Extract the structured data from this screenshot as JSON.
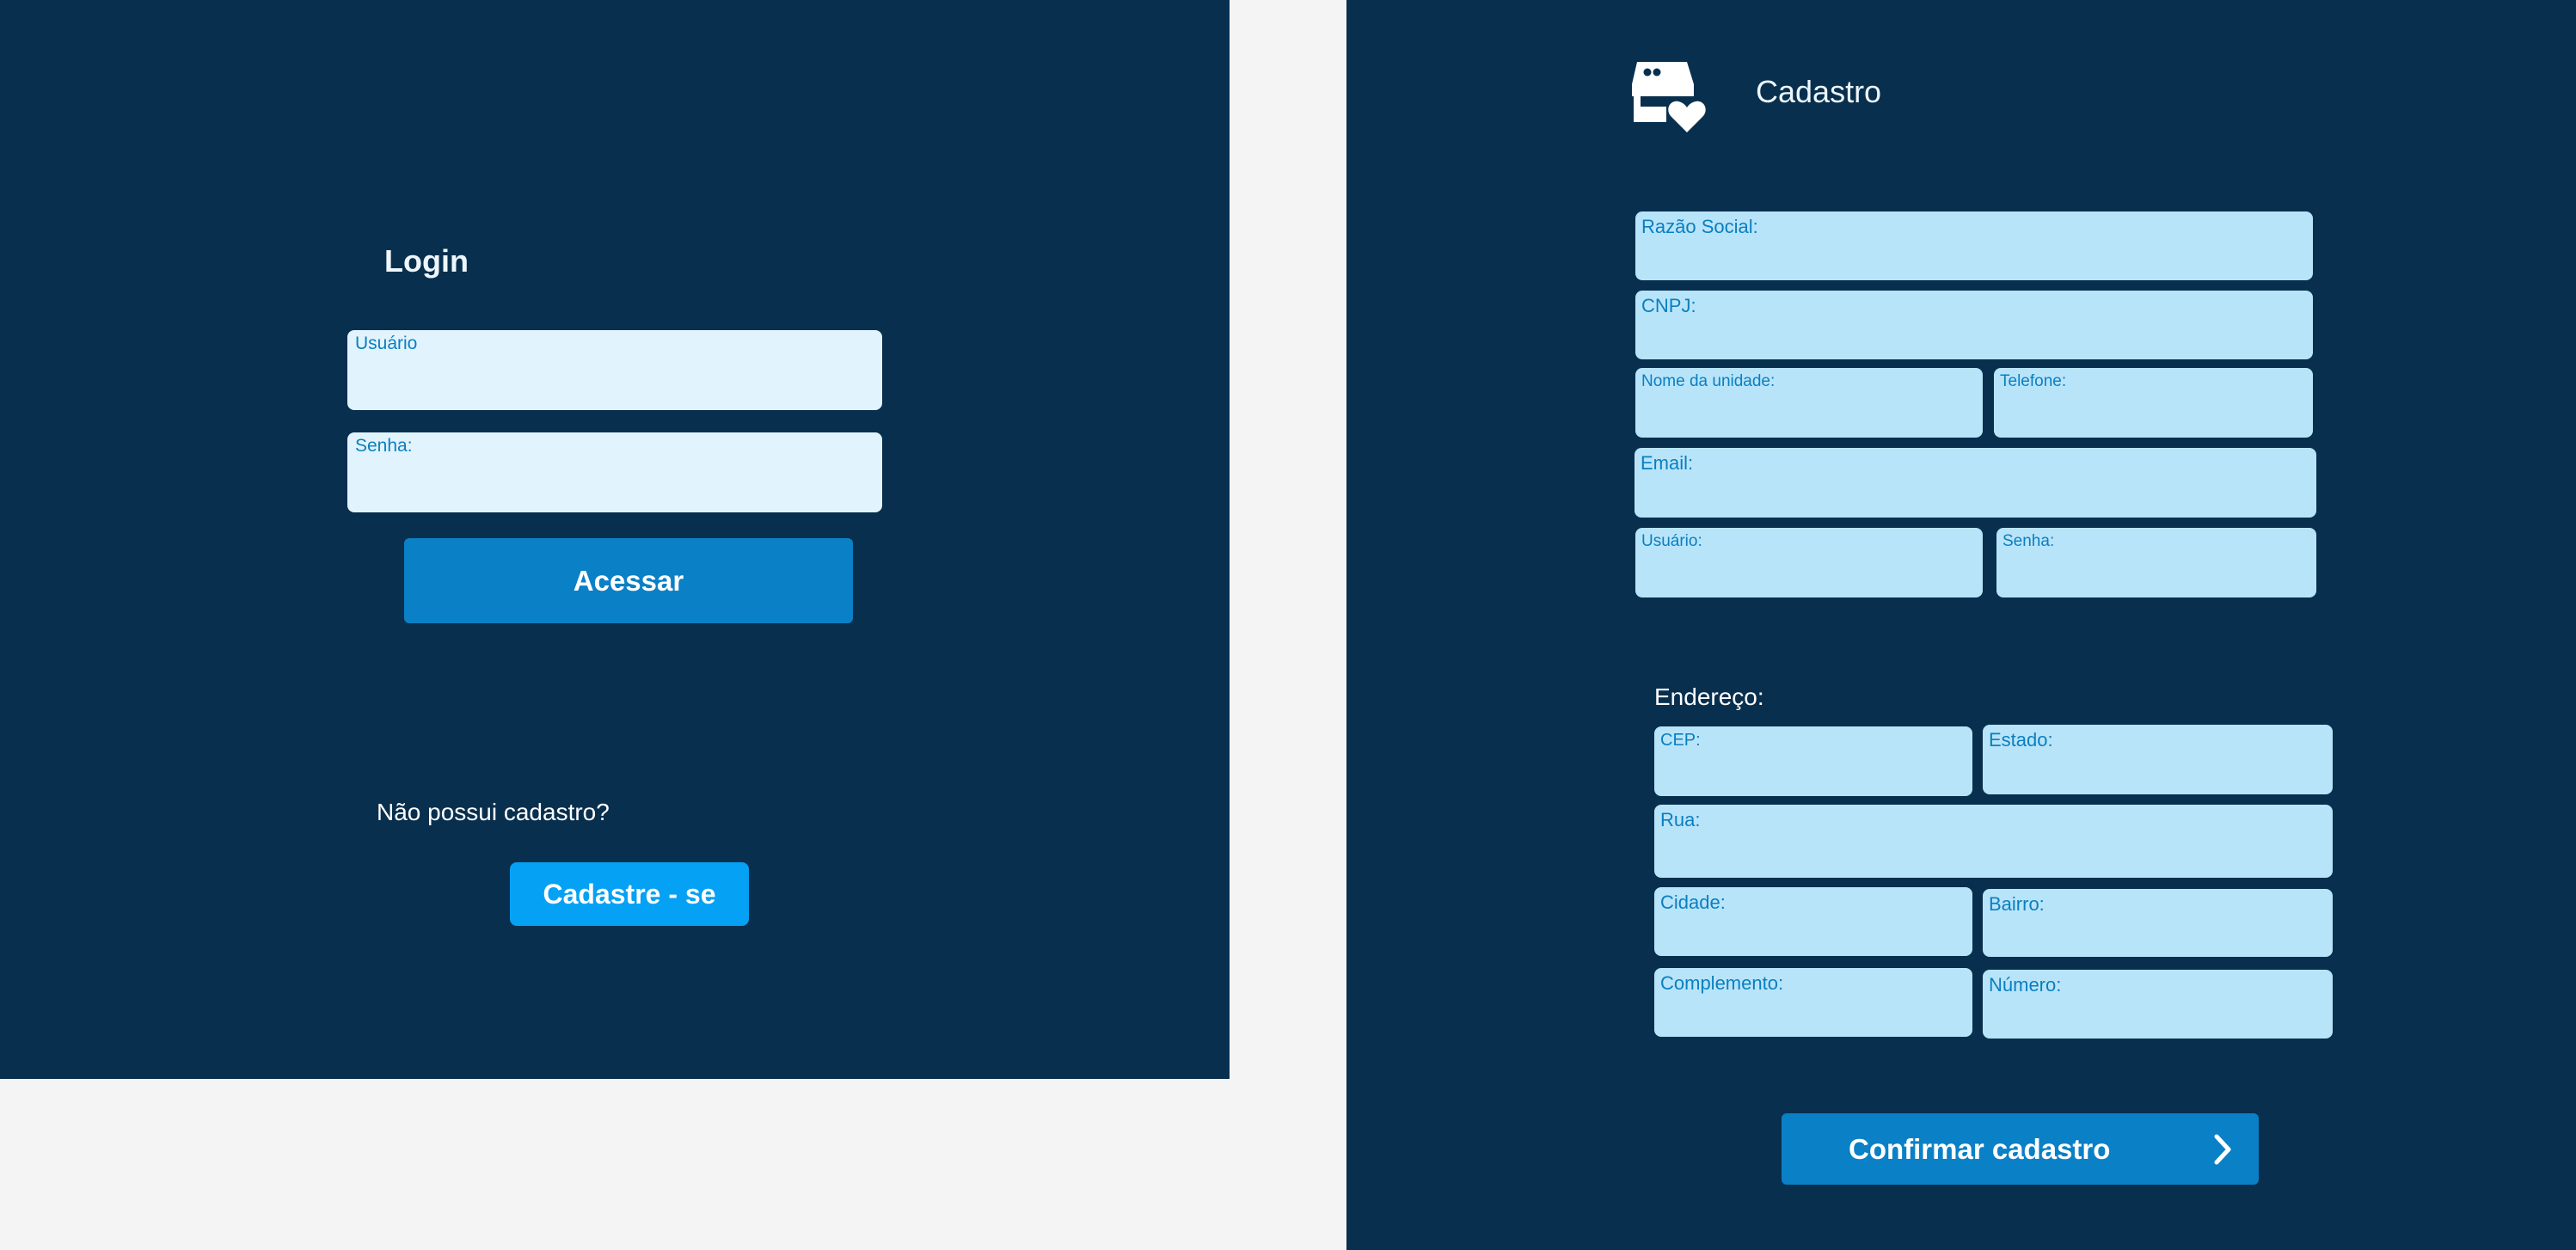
{
  "login": {
    "title": "Login",
    "username_label": "Usuário",
    "password_label": "Senha:",
    "submit_label": "Acessar",
    "no_account_text": "Não possui cadastro?",
    "register_label": "Cadastre - se"
  },
  "signup": {
    "title": "Cadastro",
    "logo_icon": "store-heart-icon",
    "fields": {
      "razao_social": "Razão Social:",
      "cnpj": "CNPJ:",
      "nome_unidade": "Nome da unidade:",
      "telefone": "Telefone:",
      "email": "Email:",
      "usuario": "Usuário:",
      "senha": "Senha:"
    },
    "address_heading": "Endereço:",
    "address": {
      "cep": "CEP:",
      "estado": "Estado:",
      "rua": "Rua:",
      "cidade": "Cidade:",
      "bairro": "Bairro:",
      "complemento": "Complemento:",
      "numero": "Número:"
    },
    "confirm_label": "Confirmar cadastro",
    "confirm_icon": "chevron-right-icon"
  },
  "colors": {
    "panel_bg": "#082f4e",
    "page_bg": "#f4f4f4",
    "field_bg": "#b8e4fa",
    "login_field_bg": "#e1f3fd",
    "field_label": "#0a7fc0",
    "primary_button": "#0a80c6",
    "secondary_button": "#05a1f4"
  }
}
